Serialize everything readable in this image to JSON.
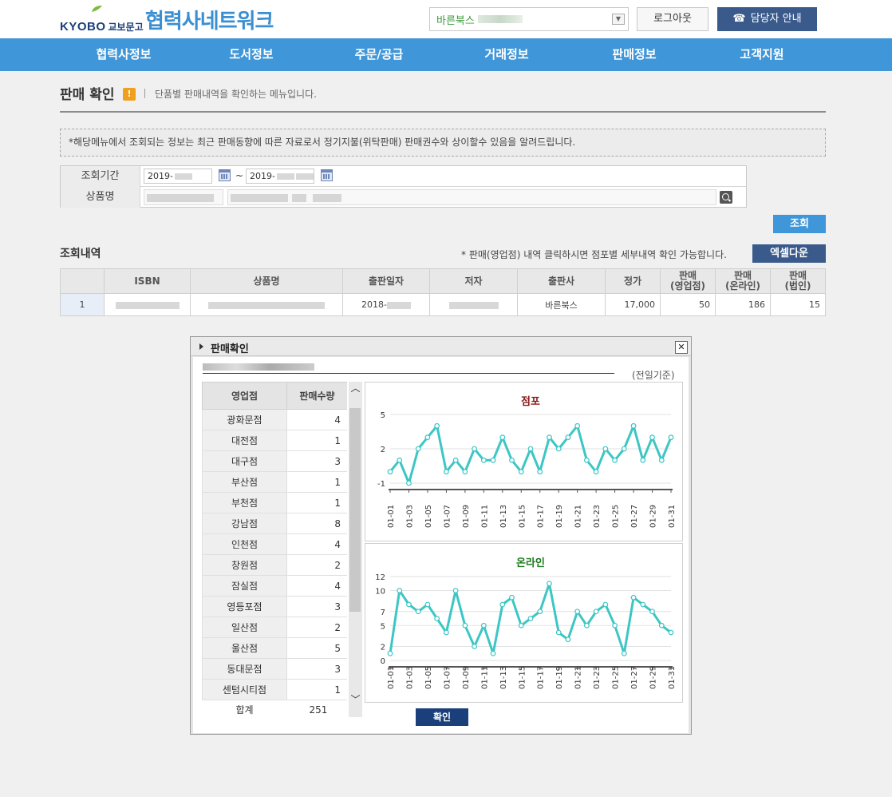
{
  "header": {
    "logo_kyobo": "KYOBO",
    "logo_kr": "교보문고",
    "site_title": "협력사네트워크",
    "vendor_select": "바른북스",
    "logout": "로그아웃",
    "contact": "담당자 안내"
  },
  "nav": [
    "협력사정보",
    "도서정보",
    "주문/공급",
    "거래정보",
    "판매정보",
    "고객지원"
  ],
  "page": {
    "title": "판매 확인",
    "badge": "!",
    "desc": "단품별 판매내역을 확인하는 메뉴입니다.",
    "notice": "*해당메뉴에서 조회되는 정보는 최근 판매동향에 따른 자료로서 정기지불(위탁판매) 판매권수와 상이할수 있음을 알려드립니다."
  },
  "search": {
    "period_label": "조회기간",
    "date_from": "2019-",
    "date_to": "2019-",
    "tilde": "~",
    "product_label": "상품명",
    "query_button": "조회"
  },
  "results": {
    "title": "조회내역",
    "note": "* 판매(영업점) 내역 클릭하시면 점포별 세부내역 확인 가능합니다.",
    "excel_button": "엑셀다운",
    "headers": [
      "",
      "ISBN",
      "상품명",
      "출판일자",
      "저자",
      "출판사",
      "정가",
      "판매\n(영업점)",
      "판매\n(온라인)",
      "판매\n(법인)"
    ],
    "row": {
      "idx": "1",
      "pub_date": "2018-",
      "publisher": "바른북스",
      "price": "17,000",
      "sales_store": "50",
      "sales_online": "186",
      "sales_corp": "15"
    }
  },
  "popup": {
    "title": "판매확인",
    "close": "✕",
    "basis": "(전일기준)",
    "store_header": "영업점",
    "qty_header": "판매수량",
    "stores": [
      {
        "name": "광화문점",
        "qty": "4"
      },
      {
        "name": "대전점",
        "qty": "1"
      },
      {
        "name": "대구점",
        "qty": "3"
      },
      {
        "name": "부산점",
        "qty": "1"
      },
      {
        "name": "부천점",
        "qty": "1"
      },
      {
        "name": "강남점",
        "qty": "8"
      },
      {
        "name": "인천점",
        "qty": "4"
      },
      {
        "name": "창원점",
        "qty": "2"
      },
      {
        "name": "잠실점",
        "qty": "4"
      },
      {
        "name": "영등포점",
        "qty": "3"
      },
      {
        "name": "일산점",
        "qty": "2"
      },
      {
        "name": "울산점",
        "qty": "5"
      },
      {
        "name": "동대문점",
        "qty": "3"
      },
      {
        "name": "센텀시티점",
        "qty": "1"
      }
    ],
    "total_label": "합계",
    "total_value": "251",
    "confirm": "확인",
    "colors": {
      "line": "#3cc6c4",
      "title_store": "#8b1a1a",
      "title_online": "#1a7a1a"
    }
  },
  "chart_data": [
    {
      "type": "line",
      "title": "점포",
      "x": [
        "01-01",
        "01-02",
        "01-03",
        "01-04",
        "01-05",
        "01-06",
        "01-07",
        "01-08",
        "01-09",
        "01-10",
        "01-11",
        "01-12",
        "01-13",
        "01-14",
        "01-15",
        "01-16",
        "01-17",
        "01-18",
        "01-19",
        "01-20",
        "01-21",
        "01-22",
        "01-23",
        "01-24",
        "01-25",
        "01-26",
        "01-27",
        "01-28",
        "01-29",
        "01-30",
        "01-31"
      ],
      "xticks": [
        "01-01",
        "01-03",
        "01-05",
        "01-07",
        "01-09",
        "01-11",
        "01-13",
        "01-15",
        "01-17",
        "01-19",
        "01-21",
        "01-23",
        "01-25",
        "01-27",
        "01-29",
        "01-31"
      ],
      "values": [
        0,
        1,
        -1,
        2,
        3,
        4,
        0,
        1,
        0,
        2,
        1,
        1,
        3,
        1,
        0,
        2,
        0,
        3,
        2,
        3,
        4,
        1,
        0,
        2,
        1,
        2,
        4,
        1,
        3,
        1,
        3
      ],
      "yticks": [
        5,
        2,
        -1
      ],
      "ylim": [
        -1,
        5
      ]
    },
    {
      "type": "line",
      "title": "온라인",
      "x": [
        "01-01",
        "01-02",
        "01-03",
        "01-04",
        "01-05",
        "01-06",
        "01-07",
        "01-08",
        "01-09",
        "01-10",
        "01-11",
        "01-12",
        "01-13",
        "01-14",
        "01-15",
        "01-16",
        "01-17",
        "01-18",
        "01-19",
        "01-20",
        "01-21",
        "01-22",
        "01-23",
        "01-24",
        "01-25",
        "01-26",
        "01-27",
        "01-28",
        "01-29",
        "01-30",
        "01-31"
      ],
      "xticks": [
        "01-01",
        "01-03",
        "01-05",
        "01-07",
        "01-09",
        "01-11",
        "01-13",
        "01-15",
        "01-17",
        "01-19",
        "01-21",
        "01-23",
        "01-25",
        "01-27",
        "01-29",
        "01-31"
      ],
      "values": [
        1,
        10,
        8,
        7,
        8,
        6,
        4,
        10,
        5,
        2,
        5,
        1,
        8,
        9,
        5,
        6,
        7,
        11,
        4,
        3,
        7,
        5,
        7,
        8,
        5,
        1,
        9,
        8,
        7,
        5,
        4
      ],
      "yticks": [
        12,
        10,
        7,
        5,
        2,
        0
      ],
      "ylim": [
        0,
        12
      ]
    }
  ]
}
